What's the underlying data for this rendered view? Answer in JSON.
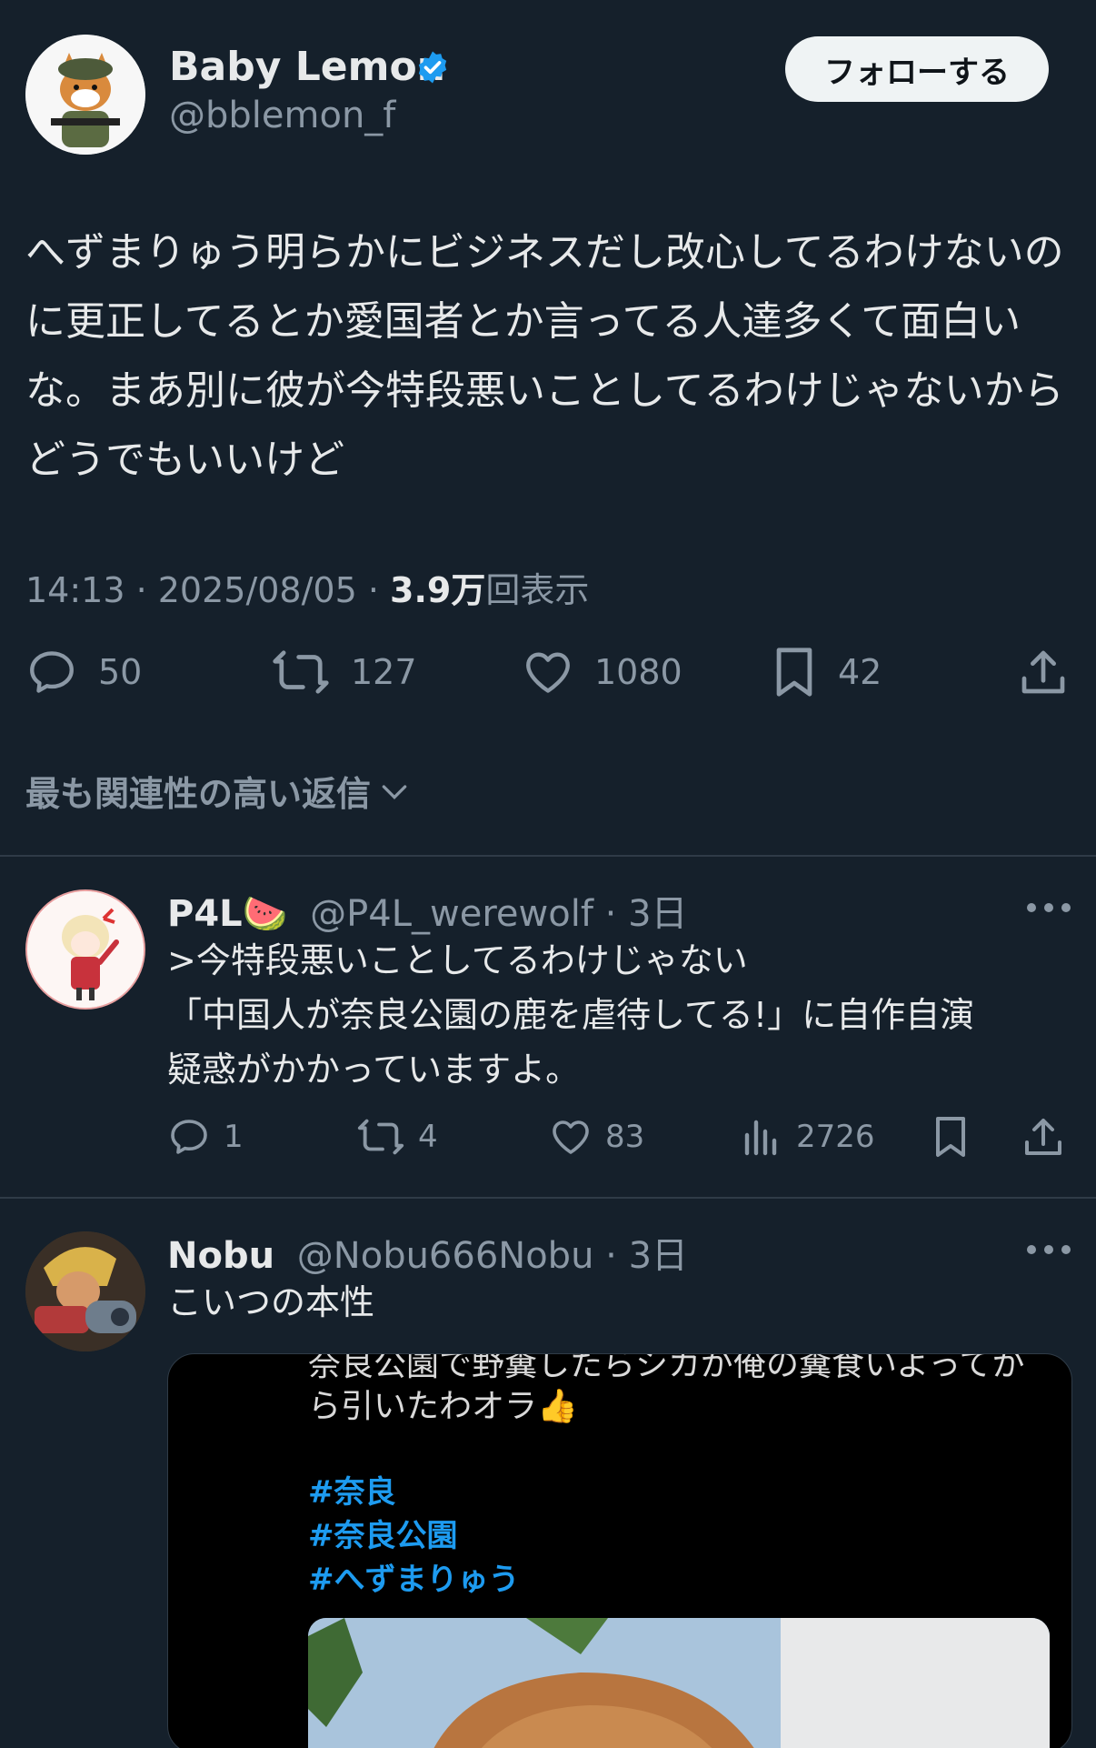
{
  "author": {
    "name": "Baby Lemon",
    "handle": "@bblemon_f",
    "verified": true,
    "follow_label": "フォローする"
  },
  "tweet": {
    "text": "へずまりゅう明らかにビジネスだし改心してるわけないのに更正してるとか愛国者とか言ってる人達多くて面白いな。まあ別に彼が今特段悪いことしてるわけじゃないからどうでもいいけど",
    "time": "14:13 · 2025/08/05 · ",
    "views_count": "3.9万",
    "views_label": "回表示"
  },
  "actions": {
    "replies": "50",
    "retweets": "127",
    "likes": "1080",
    "bookmarks": "42"
  },
  "sort_label": "最も関連性の高い返信",
  "replies": [
    {
      "name": "P4L🍉",
      "handle": "@P4L_werewolf",
      "time": "· 3日",
      "text_lines": [
        ">今特段悪いことしてるわけじゃない",
        "「中国人が奈良公園の鹿を虐待してる!」に自作自演",
        "疑惑がかかっていますよ。"
      ],
      "replies": "1",
      "retweets": "4",
      "likes": "83",
      "views": "2726"
    },
    {
      "name": "Nobu",
      "handle": "@Nobu666Nobu",
      "time": "· 3日",
      "text": "こいつの本性",
      "media": {
        "cut_line": "奈良公園で野糞したらシカが俺の糞食いよってか",
        "line2": "ら引いたわオラ👍",
        "tags": [
          "#奈良",
          "#奈良公園",
          "#へずまりゅう"
        ]
      }
    }
  ],
  "colors": {
    "background": "#15202b",
    "text": "#e7e9ea",
    "muted": "#8b98a5",
    "accent": "#1d9bf0",
    "divider": "#2f3b47"
  }
}
